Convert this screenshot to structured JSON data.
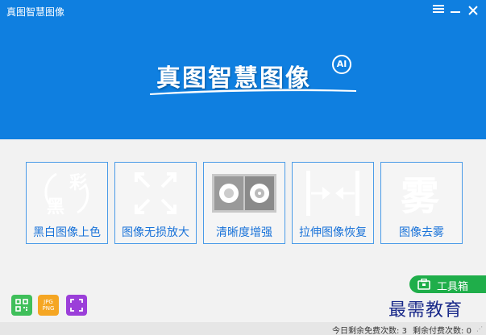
{
  "window": {
    "title": "真图智慧图像"
  },
  "logo": {
    "text": "真图智慧图像",
    "badge": "AI"
  },
  "tools": [
    {
      "label": "黑白图像上色",
      "icon": "colorize-icon",
      "icon_text_a": "黑",
      "icon_text_b": "彩"
    },
    {
      "label": "图像无损放大",
      "icon": "enlarge-arrows-icon"
    },
    {
      "label": "清晰度增强",
      "icon": "sharpen-roses-icon"
    },
    {
      "label": "拉伸图像恢复",
      "icon": "stretch-restore-icon"
    },
    {
      "label": "图像去雾",
      "icon": "dehaze-icon",
      "icon_text": "雾"
    }
  ],
  "bottom_icons": [
    {
      "name": "qr-code-icon"
    },
    {
      "name": "format-convert-icon",
      "line1": "JPG",
      "line2": "PNG"
    },
    {
      "name": "crop-icon"
    }
  ],
  "toolbox": {
    "label": "工具箱"
  },
  "watermark": {
    "text": "最需教育"
  },
  "status": {
    "free_label": "今日剩余免费次数:",
    "free_count": "3",
    "paid_label": "剩余付费次数:",
    "paid_count": "0"
  },
  "colors": {
    "header_blue": "#0f7fe0",
    "card_border": "#4a9be8",
    "label_blue": "#1a73d9",
    "toolbox_green": "#1fae4a"
  }
}
